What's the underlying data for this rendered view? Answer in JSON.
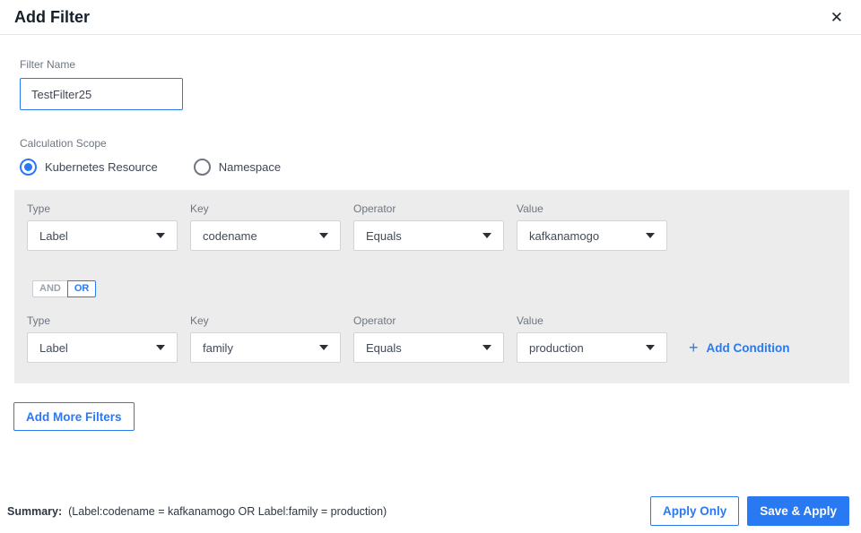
{
  "dialog": {
    "title": "Add Filter",
    "close_icon": "✕"
  },
  "filter_name": {
    "label": "Filter Name",
    "value": "TestFilter25"
  },
  "calculation_scope": {
    "label": "Calculation Scope",
    "options": [
      {
        "label": "Kubernetes Resource",
        "selected": true
      },
      {
        "label": "Namespace",
        "selected": false
      }
    ]
  },
  "conditions": {
    "column_labels": {
      "type": "Type",
      "key": "Key",
      "operator": "Operator",
      "value": "Value"
    },
    "rows": [
      {
        "type": "Label",
        "key": "codename",
        "operator": "Equals",
        "value": "kafkanamogo"
      },
      {
        "type": "Label",
        "key": "family",
        "operator": "Equals",
        "value": "production"
      }
    ],
    "logic_toggle": {
      "and_label": "AND",
      "or_label": "OR",
      "selected": "OR"
    },
    "add_condition": {
      "plus": "+",
      "label": "Add Condition"
    }
  },
  "actions": {
    "add_more_filters": "Add More Filters",
    "apply_only": "Apply Only",
    "save_and_apply": "Save & Apply"
  },
  "summary": {
    "label": "Summary:",
    "text": "(Label:codename = kafkanamogo OR Label:family = production)"
  },
  "colors": {
    "accent_blue": "#2979f2",
    "panel_gray": "#ececec"
  }
}
